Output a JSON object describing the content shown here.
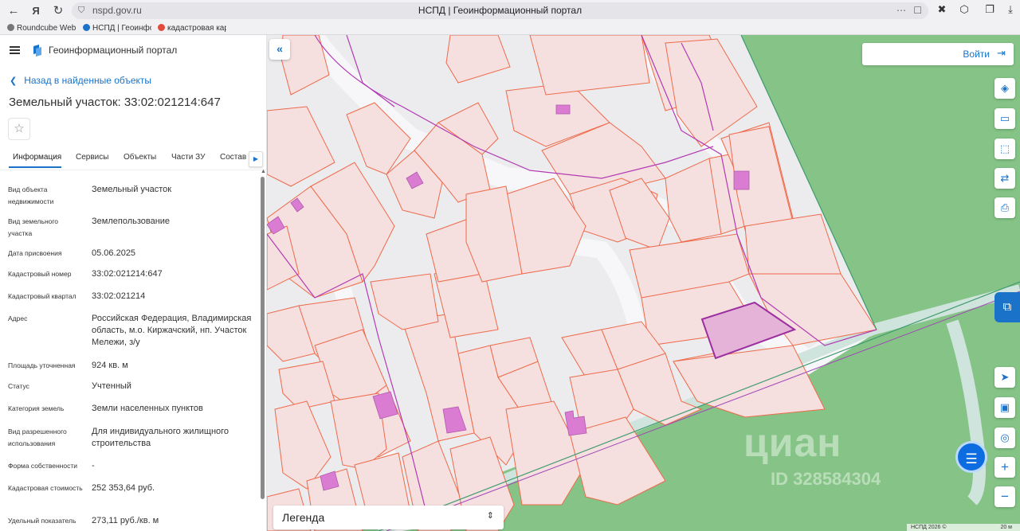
{
  "browser": {
    "url": "nspd.gov.ru",
    "page_title": "НСПД | Геоинформационный портал",
    "bookmarks": [
      {
        "label": "Roundcube Webm"
      },
      {
        "label": "НСПД | Геоинфор"
      },
      {
        "label": "кадастровая карт"
      }
    ]
  },
  "panel": {
    "portal_title": "Геоинформационный портал",
    "back_label": "Назад в найденные объекты",
    "object_title": "Земельный участок: 33:02:021214:647",
    "tabs": [
      {
        "label": "Информация",
        "active": true
      },
      {
        "label": "Сервисы"
      },
      {
        "label": "Объекты"
      },
      {
        "label": "Части ЗУ"
      },
      {
        "label": "Состав"
      }
    ],
    "info": [
      {
        "label": "Вид объекта недвижимости",
        "value": "Земельный участок"
      },
      {
        "label": "Вид земельного участка",
        "value": "Землепользование"
      },
      {
        "label": "Дата присвоения",
        "value": "05.06.2025"
      },
      {
        "label": "Кадастровый номер",
        "value": "33:02:021214:647"
      },
      {
        "label": "Кадастровый квартал",
        "value": "33:02:021214"
      },
      {
        "label": "Адрес",
        "value": "Российская Федерация, Владимирская область, м.о. Киржачский, нп. Участок Мележи, з/у"
      },
      {
        "label": "Площадь уточненная",
        "value": "924 кв. м"
      },
      {
        "label": "Статус",
        "value": "Учтенный"
      },
      {
        "label": "Категория земель",
        "value": "Земли населенных пунктов"
      },
      {
        "label": "Вид разрешенного использования",
        "value": "Для индивидуального жилищного строительства"
      },
      {
        "label": "Форма собственности",
        "value": "-"
      },
      {
        "label": "Кадастровая стоимость",
        "value": "252 353,64 руб."
      },
      {
        "label": "Удельный показатель",
        "value": "273,11 руб./кв. м"
      }
    ]
  },
  "map": {
    "login_label": "Войти",
    "legend_label": "Легенда",
    "copyright": "НСПД 2026 ©",
    "scale_label": "20 м",
    "watermark": "циан",
    "watermark_id": "ID 328584304",
    "colors": {
      "parcel_fill": "#f5dfdf",
      "parcel_stroke": "#ee6a4a",
      "boundary": "#b33bb3",
      "building": "#d97cd2",
      "green": "#85c486",
      "road": "#f7f7f9",
      "selected_fill": "#e5b3d7",
      "accent": "#1a73c9"
    }
  }
}
